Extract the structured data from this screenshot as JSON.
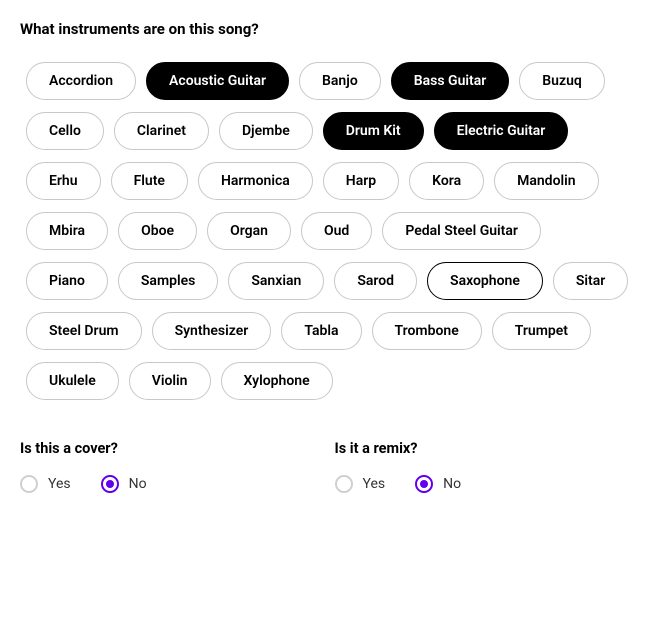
{
  "question": "What instruments are on this song?",
  "instruments": [
    {
      "label": "Accordion",
      "selected": false
    },
    {
      "label": "Acoustic Guitar",
      "selected": true
    },
    {
      "label": "Banjo",
      "selected": false
    },
    {
      "label": "Bass Guitar",
      "selected": true
    },
    {
      "label": "Buzuq",
      "selected": false
    },
    {
      "label": "Cello",
      "selected": false
    },
    {
      "label": "Clarinet",
      "selected": false
    },
    {
      "label": "Djembe",
      "selected": false
    },
    {
      "label": "Drum Kit",
      "selected": true
    },
    {
      "label": "Electric Guitar",
      "selected": true
    },
    {
      "label": "Erhu",
      "selected": false
    },
    {
      "label": "Flute",
      "selected": false
    },
    {
      "label": "Harmonica",
      "selected": false
    },
    {
      "label": "Harp",
      "selected": false
    },
    {
      "label": "Kora",
      "selected": false
    },
    {
      "label": "Mandolin",
      "selected": false
    },
    {
      "label": "Mbira",
      "selected": false
    },
    {
      "label": "Oboe",
      "selected": false
    },
    {
      "label": "Organ",
      "selected": false
    },
    {
      "label": "Oud",
      "selected": false
    },
    {
      "label": "Pedal Steel Guitar",
      "selected": false
    },
    {
      "label": "Piano",
      "selected": false
    },
    {
      "label": "Samples",
      "selected": false
    },
    {
      "label": "Sanxian",
      "selected": false
    },
    {
      "label": "Sarod",
      "selected": false
    },
    {
      "label": "Saxophone",
      "selected": false,
      "focus": true
    },
    {
      "label": "Sitar",
      "selected": false
    },
    {
      "label": "Steel Drum",
      "selected": false
    },
    {
      "label": "Synthesizer",
      "selected": false
    },
    {
      "label": "Tabla",
      "selected": false
    },
    {
      "label": "Trombone",
      "selected": false
    },
    {
      "label": "Trumpet",
      "selected": false
    },
    {
      "label": "Ukulele",
      "selected": false
    },
    {
      "label": "Violin",
      "selected": false
    },
    {
      "label": "Xylophone",
      "selected": false
    }
  ],
  "cover": {
    "question": "Is this a cover?",
    "options": {
      "yes": "Yes",
      "no": "No"
    },
    "value": "no"
  },
  "remix": {
    "question": "Is it a remix?",
    "options": {
      "yes": "Yes",
      "no": "No"
    },
    "value": "no"
  }
}
